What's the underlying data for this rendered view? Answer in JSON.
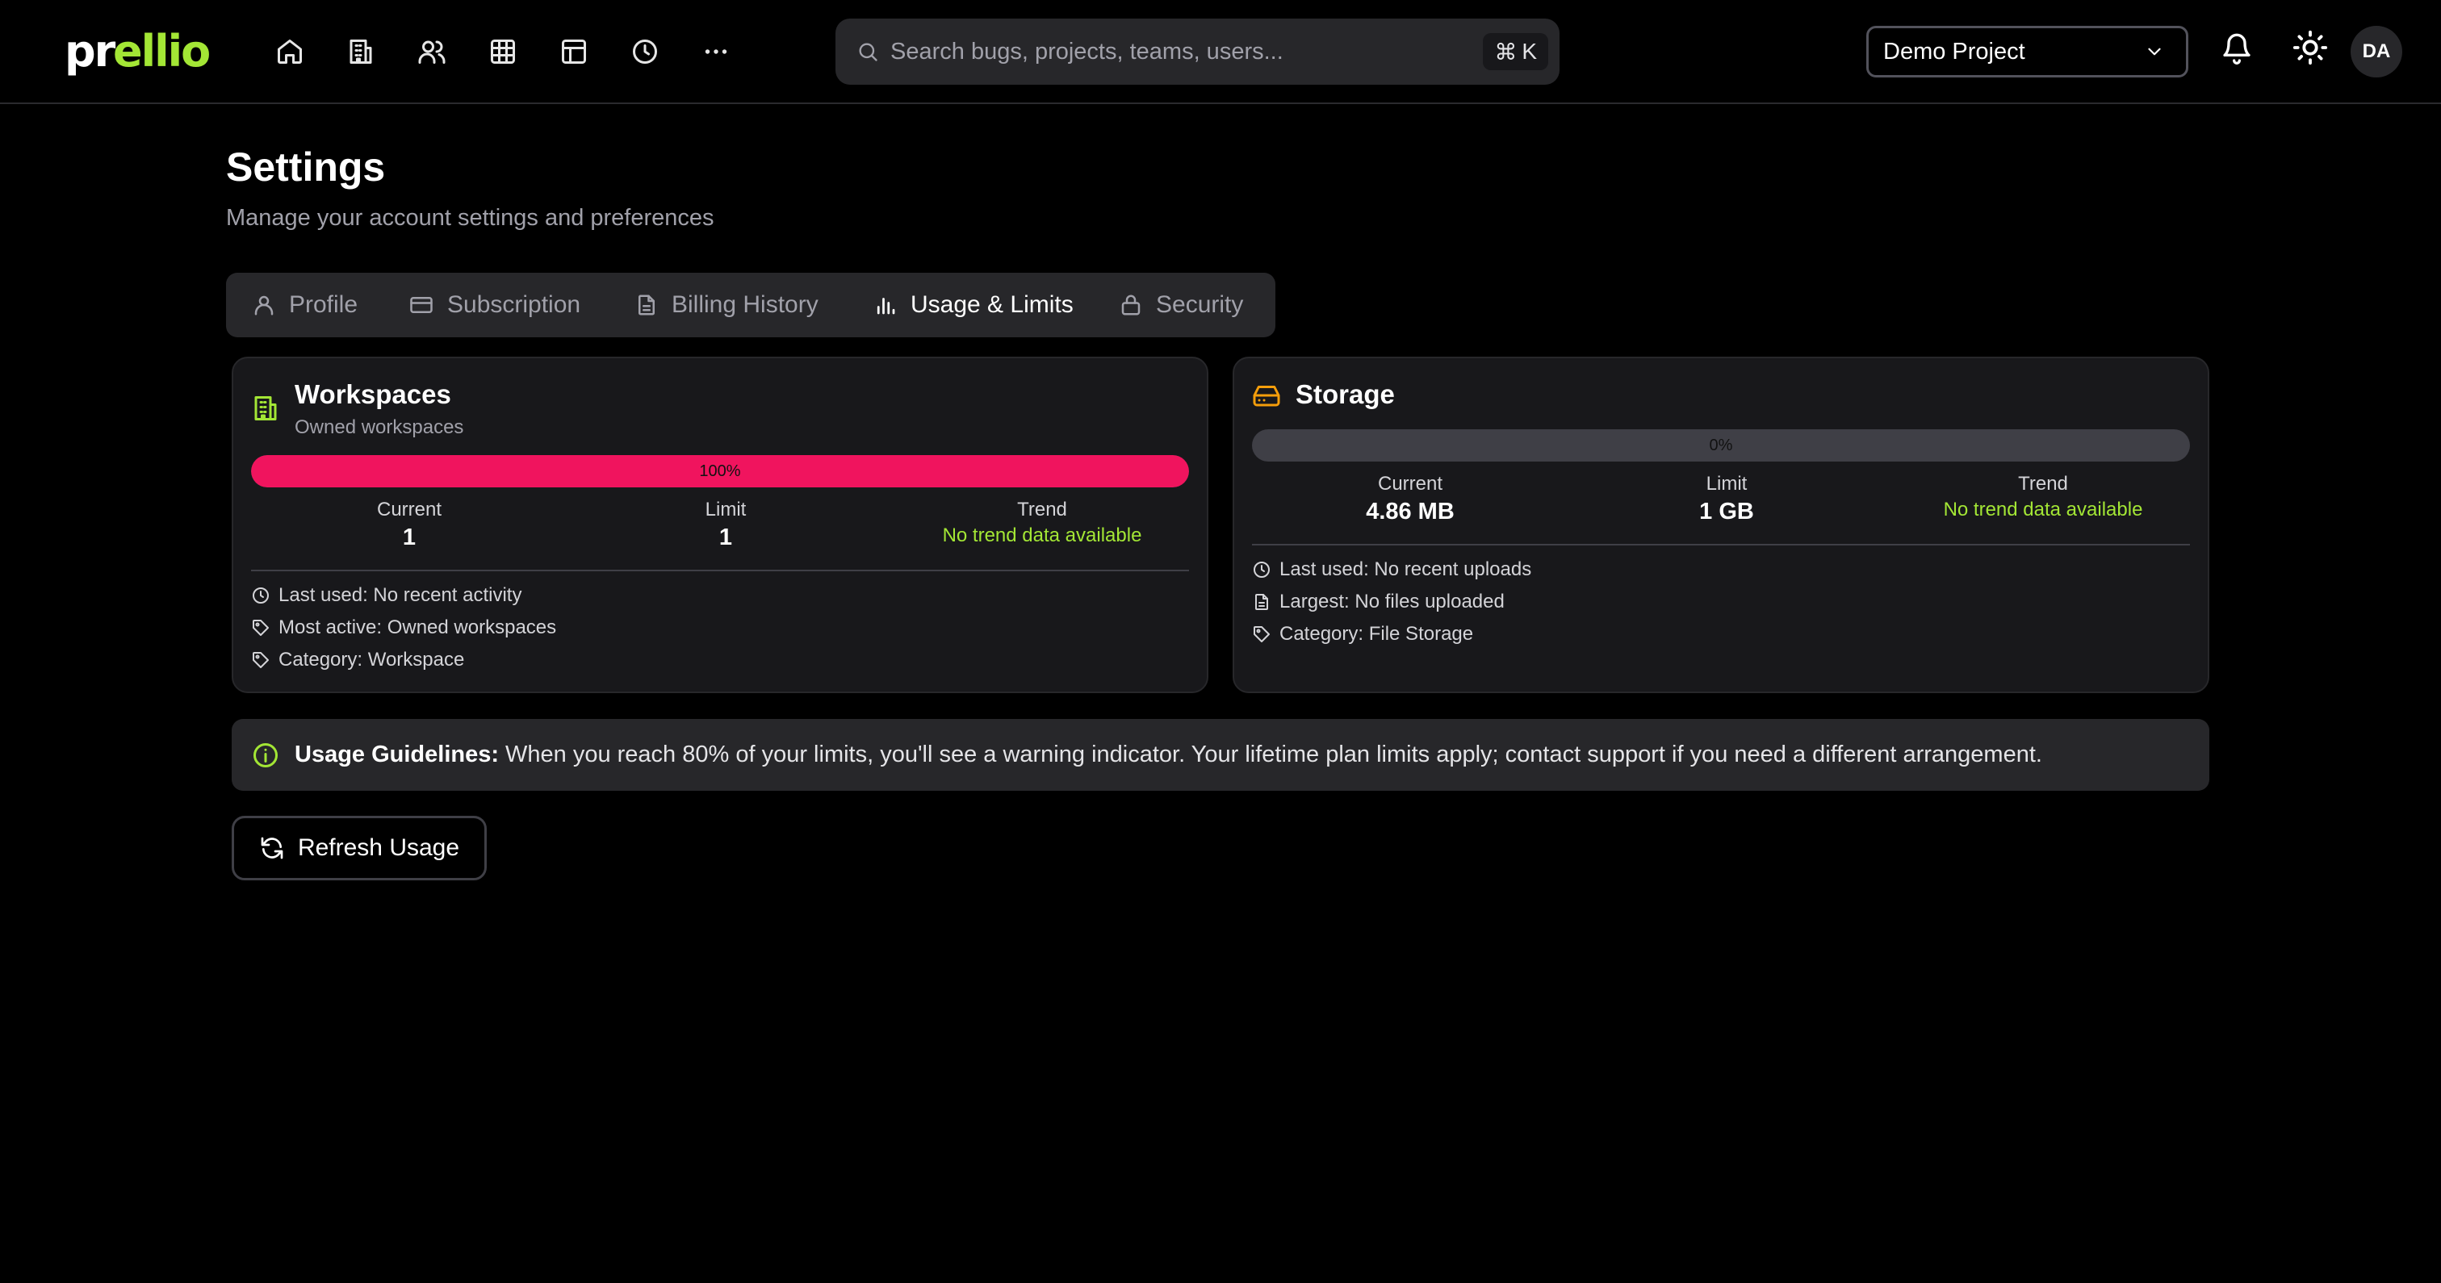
{
  "brand": {
    "logo_text": "prellio",
    "accent_color": "#a3e635"
  },
  "nav": {
    "icons": [
      "home-icon",
      "building-icon",
      "users-icon",
      "grid-icon",
      "layout-icon",
      "clock-icon",
      "more-icon"
    ]
  },
  "search": {
    "placeholder": "Search bugs, projects, teams, users...",
    "shortcut_symbol": "⌘",
    "shortcut_key": "K"
  },
  "project_selector": {
    "selected": "Demo Project"
  },
  "user": {
    "initials": "DA"
  },
  "page": {
    "title": "Settings",
    "subtitle": "Manage your account settings and preferences"
  },
  "tabs": [
    {
      "label": "Profile",
      "icon": "user-icon",
      "active": false
    },
    {
      "label": "Subscription",
      "icon": "credit-card-icon",
      "active": false
    },
    {
      "label": "Billing History",
      "icon": "document-icon",
      "active": false
    },
    {
      "label": "Usage & Limits",
      "icon": "bar-chart-icon",
      "active": true
    },
    {
      "label": "Security",
      "icon": "lock-icon",
      "active": false
    }
  ],
  "workspaces": {
    "title": "Workspaces",
    "subtitle": "Owned workspaces",
    "usage_percent_label": "100%",
    "usage_fraction": 1.0,
    "bar_color": "#f0145e",
    "current_label": "Current",
    "current_value": "1",
    "limit_label": "Limit",
    "limit_value": "1",
    "trend_label": "Trend",
    "trend_value": "No trend data available",
    "last_used": "Last used: No recent activity",
    "most_active": "Most active: Owned workspaces",
    "category": "Category: Workspace"
  },
  "storage": {
    "title": "Storage",
    "usage_percent_label": "0%",
    "usage_fraction": 0.0,
    "current_label": "Current",
    "current_value": "4.86 MB",
    "limit_label": "Limit",
    "limit_value": "1 GB",
    "trend_label": "Trend",
    "trend_value": "No trend data available",
    "last_used": "Last used: No recent uploads",
    "largest": "Largest: No files uploaded",
    "category": "Category: File Storage"
  },
  "guidelines": {
    "title": "Usage Guidelines:",
    "text": "When you reach 80% of your limits, you'll see a warning indicator. Your lifetime plan limits apply; contact support if you need a different arrangement."
  },
  "refresh_button": {
    "label": "Refresh Usage"
  }
}
